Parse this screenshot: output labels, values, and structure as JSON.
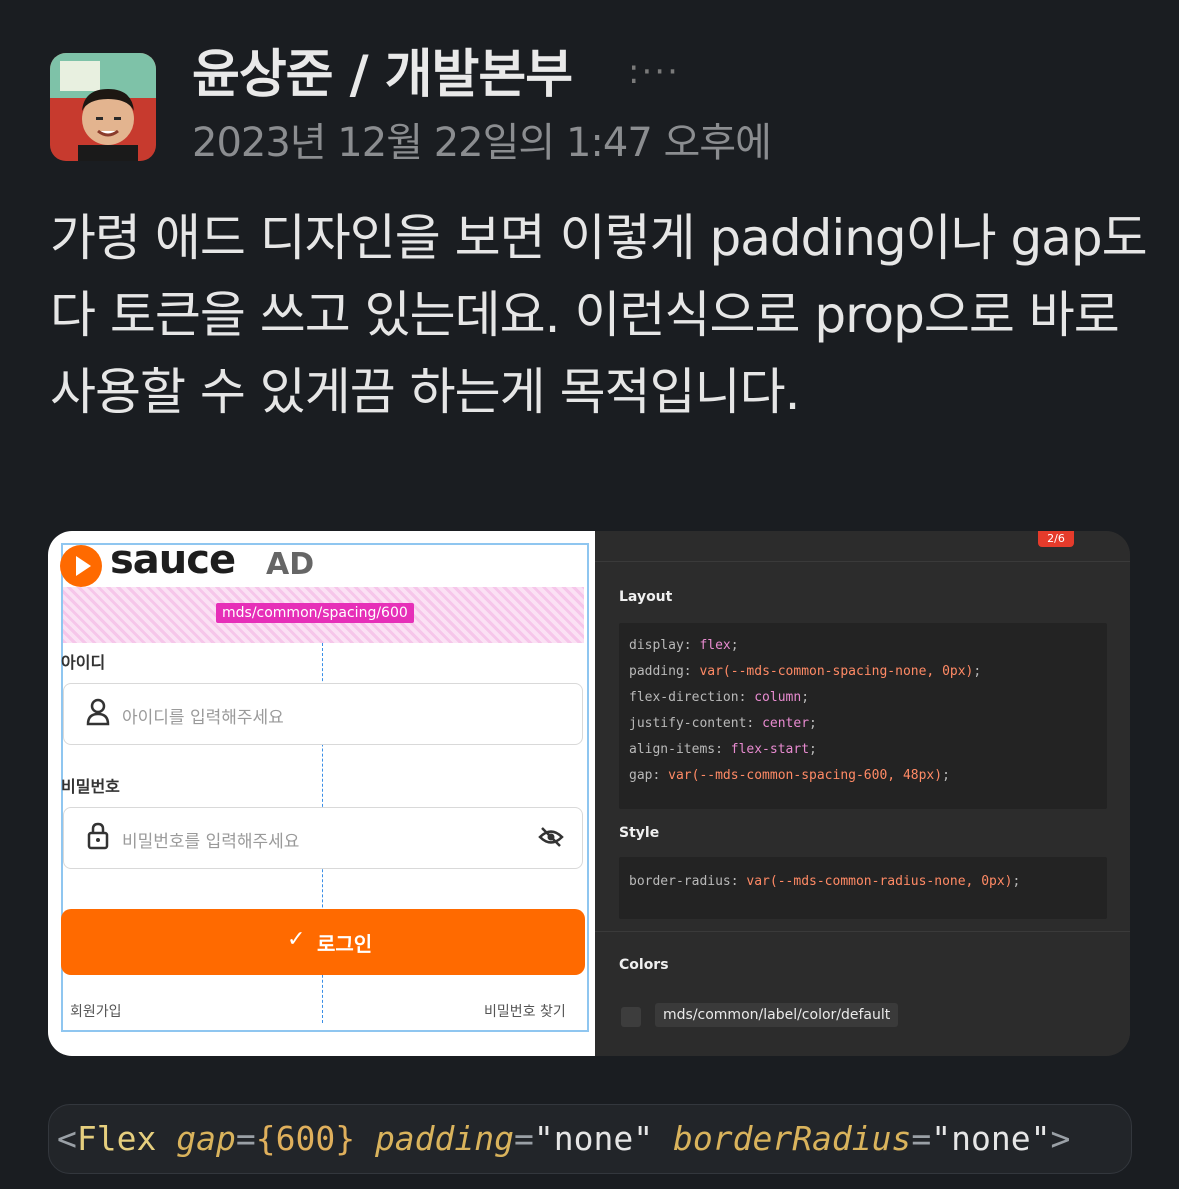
{
  "post": {
    "author": "윤상준 / 개발본부",
    "more": ":···",
    "timestamp": "2023년 12월 22일의 1:47 오후에",
    "message": "가령 애드 디자인을 보면 이렇게 padding이나 gap도 다 토큰을 쓰고 있는데요. 이런식으로 prop으로 바로 사용할 수 있게끔 하는게 목적입니다."
  },
  "attachment": {
    "design": {
      "logo_text": "sauce",
      "logo_suffix": "AD",
      "spacing_token": "mds/common/spacing/600",
      "id_label": "아이디",
      "id_placeholder": "아이디를 입력해주세요",
      "password_label": "비밀번호",
      "password_placeholder": "비밀번호를 입력해주세요",
      "login_label": "로그인",
      "signup_link": "회원가입",
      "find_password_link": "비밀번호 찾기"
    },
    "inspector": {
      "page_badge": "2/6",
      "layout_heading": "Layout",
      "layout_code": [
        {
          "prop": "display",
          "value": "flex"
        },
        {
          "prop": "padding",
          "var": "var(--mds-common-spacing-none, 0px)"
        },
        {
          "prop": "flex-direction",
          "value": "column"
        },
        {
          "prop": "justify-content",
          "value": "center"
        },
        {
          "prop": "align-items",
          "value": "flex-start"
        },
        {
          "prop": "gap",
          "var": "var(--mds-common-spacing-600, 48px)"
        }
      ],
      "style_heading": "Style",
      "style_code": {
        "prop": "border-radius",
        "var": "var(--mds-common-radius-none, 0px)"
      },
      "colors_heading": "Colors",
      "color_token": "mds/common/label/color/default"
    }
  },
  "code_snippet": {
    "open": "<",
    "tag": "Flex",
    "gap_attr": "gap",
    "gap_value": "{600}",
    "padding_attr": "padding",
    "padding_value": "\"none\"",
    "radius_attr": "borderRadius",
    "radius_value": "\"none\"",
    "close": ">"
  },
  "colors": {
    "background": "#1a1d21",
    "brand_orange": "#ff6a00",
    "token_pink": "#e62fb8"
  }
}
